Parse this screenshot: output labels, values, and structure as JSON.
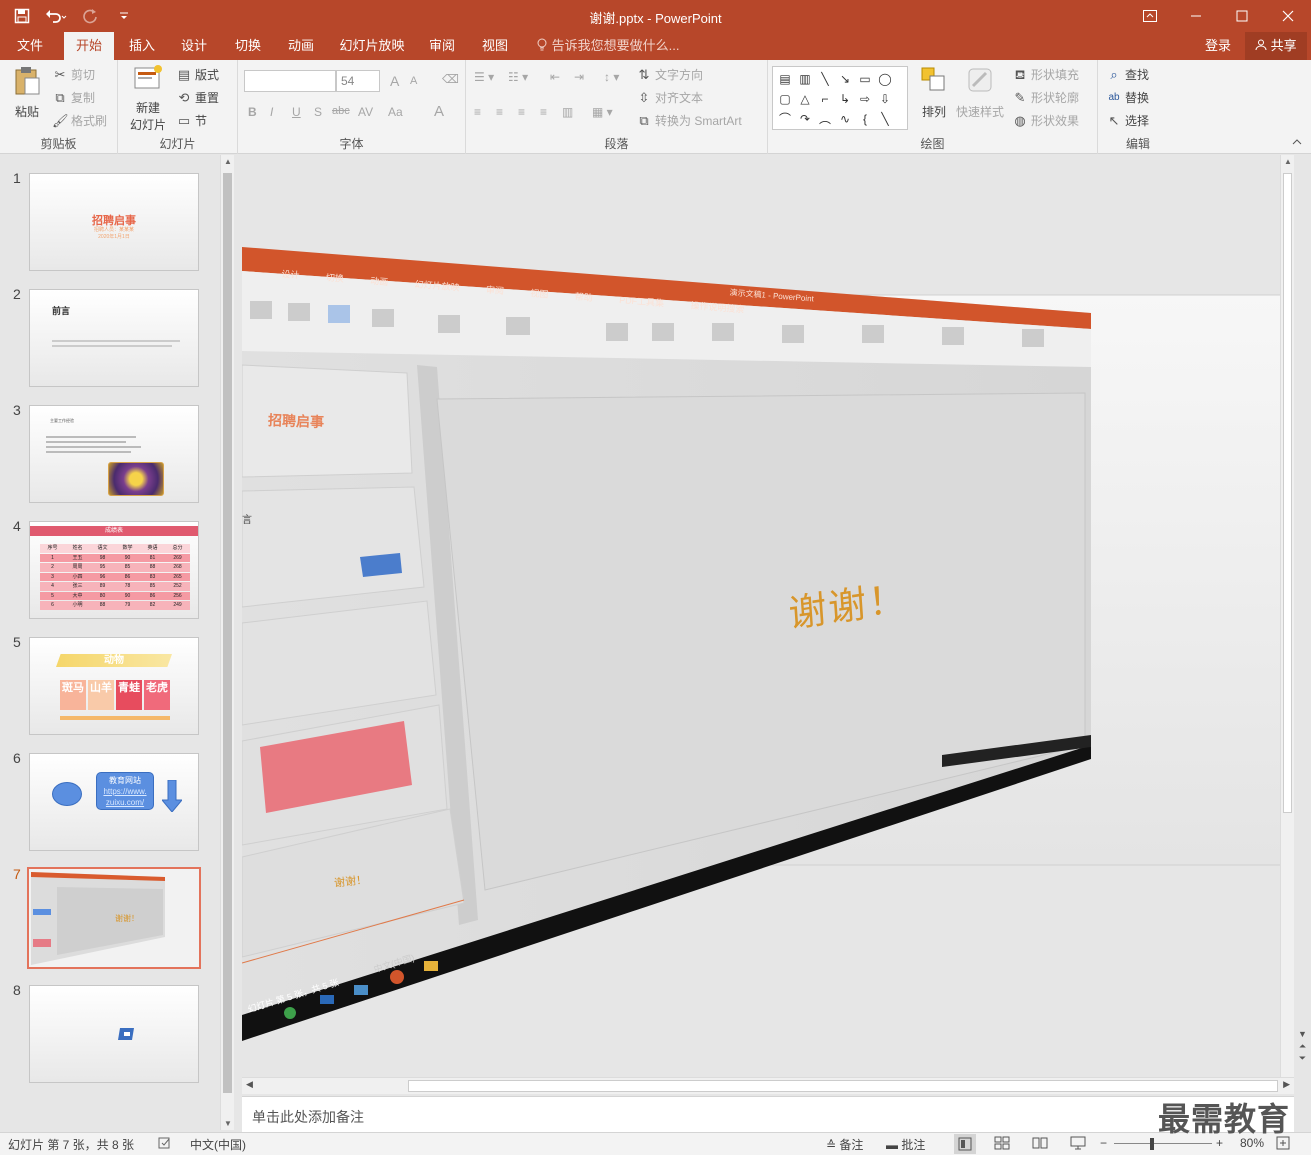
{
  "window": {
    "title": "谢谢.pptx - PowerPoint",
    "qat": {
      "save": "save-icon",
      "undo": "undo-icon",
      "redo": "redo-icon",
      "customize": "customize-icon"
    },
    "controls": {
      "ribbon_options": "▭",
      "minimize": "—",
      "maximize": "☐",
      "close": "✕"
    }
  },
  "tabs": [
    "文件",
    "开始",
    "插入",
    "设计",
    "切换",
    "动画",
    "幻灯片放映",
    "审阅",
    "视图"
  ],
  "active_tab": "开始",
  "tellme": "告诉我您想要做什么...",
  "account": {
    "login": "登录",
    "share": "共享"
  },
  "ribbon": {
    "clipboard": {
      "paste": "粘贴",
      "cut": "剪切",
      "copy": "复制",
      "format_painter": "格式刷",
      "label": "剪贴板"
    },
    "slides": {
      "new_slide_line1": "新建",
      "new_slide_line2": "幻灯片",
      "layout": "版式",
      "reset": "重置",
      "section": "节",
      "label": "幻灯片"
    },
    "font": {
      "font_name": "",
      "font_size": "54",
      "bold": "B",
      "italic": "I",
      "underline": "U",
      "shadow": "S",
      "strike": "abc",
      "spacing": "AV",
      "case": "Aa",
      "color": "A",
      "grow": "A",
      "shrink": "A",
      "label": "字体"
    },
    "paragraph": {
      "text_direction": "文字方向",
      "align_text": "对齐文本",
      "convert_smartart": "转换为 SmartArt",
      "label": "段落"
    },
    "drawing": {
      "arrange": "排列",
      "quick_styles": "快速样式",
      "shape_fill": "形状填充",
      "shape_outline": "形状轮廓",
      "shape_effects": "形状效果",
      "label": "绘图"
    },
    "editing": {
      "find": "查找",
      "replace": "替换",
      "select": "选择",
      "label": "编辑"
    }
  },
  "thumbnails": [
    {
      "num": "1",
      "title": "招聘启事",
      "sub1": "招聘人员：某某某",
      "sub2": "2020年1月1日"
    },
    {
      "num": "2",
      "title": "前言"
    },
    {
      "num": "3",
      "title": "主要工作经验"
    },
    {
      "num": "4",
      "title": "成绩表",
      "headers": [
        "序号",
        "姓名",
        "语文",
        "数学",
        "英语",
        "总分"
      ],
      "rows": [
        [
          "1",
          "王五",
          "98",
          "90",
          "81",
          "269"
        ],
        [
          "2",
          "周周",
          "95",
          "85",
          "88",
          "268"
        ],
        [
          "3",
          "小四",
          "96",
          "86",
          "83",
          "265"
        ],
        [
          "4",
          "张三",
          "89",
          "78",
          "85",
          "252"
        ],
        [
          "5",
          "大中",
          "80",
          "90",
          "86",
          "256"
        ],
        [
          "6",
          "小明",
          "88",
          "79",
          "82",
          "249"
        ]
      ]
    },
    {
      "num": "5",
      "title": "动物",
      "cells": [
        "斑马",
        "山羊",
        "青蛙",
        "老虎"
      ]
    },
    {
      "num": "6",
      "badge_title": "教育网站",
      "url_line1": "https://www.",
      "url_line2": "zuixu.com/"
    },
    {
      "num": "7",
      "caption": "谢谢！"
    },
    {
      "num": "8"
    }
  ],
  "slide": {
    "main_text": "谢谢！",
    "embedded_tabs": [
      "设计",
      "切换",
      "动画",
      "幻灯片放映",
      "审阅",
      "视图",
      "帮助",
      "PDF工具集",
      "操作说明搜索"
    ],
    "embedded_title": "演示文稿1 - PowerPoint",
    "embedded_thumb_title": "招聘启事",
    "embedded_thumb_caption": "谢谢！",
    "embedded_status": "幻灯片 第 5 张，共 5 张",
    "embedded_lang": "中文(中国)",
    "embedded_preface": "言"
  },
  "notes": {
    "placeholder": "单击此处添加备注"
  },
  "status": {
    "slide_info": "幻灯片 第 7 张，共 8 张",
    "language": "中文(中国)",
    "notes_btn": "备注",
    "comments_btn": "批注",
    "zoom": "80%"
  },
  "watermark": "最需教育",
  "colors": {
    "accent": "#b7472a",
    "orange_text": "#d8962b"
  }
}
